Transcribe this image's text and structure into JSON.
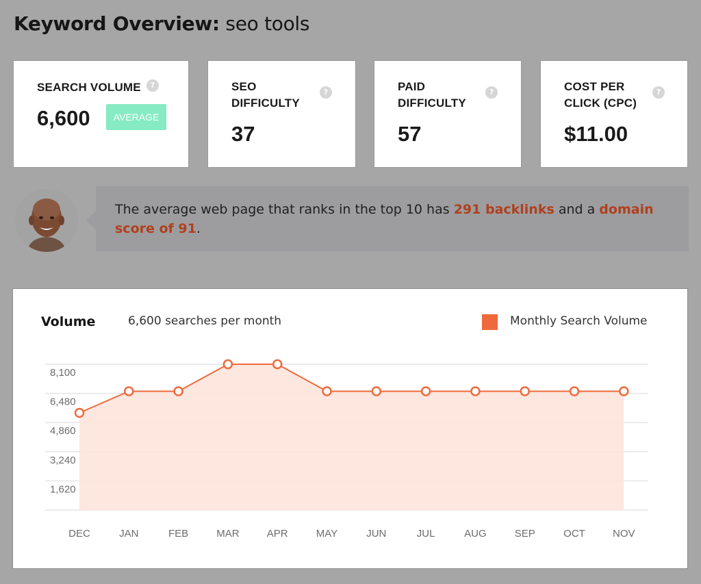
{
  "header": {
    "title_label": "Keyword Overview:",
    "keyword": "seo tools"
  },
  "metrics": [
    {
      "label_lines": [
        "SEARCH VOLUME"
      ],
      "value": "6,600",
      "badge": "AVERAGE",
      "help": "?"
    },
    {
      "label_lines": [
        "SEO",
        "DIFFICULTY"
      ],
      "value": "37",
      "help": "?"
    },
    {
      "label_lines": [
        "PAID",
        "DIFFICULTY"
      ],
      "value": "57",
      "help": "?"
    },
    {
      "label_lines": [
        "COST PER",
        "CLICK (CPC)"
      ],
      "value": "$11.00",
      "help": "?"
    }
  ],
  "tip": {
    "part1": "The average web page that ranks in the top 10 has ",
    "highlight1": "291 backlinks",
    "part2": " and a ",
    "highlight2": "domain score of 91",
    "part3": "."
  },
  "colors": {
    "accent": "#ee6a3c",
    "fill": "#fde4dc",
    "badge": "#86ebc3",
    "highlight": "#b0401d",
    "background": "#a6a6a6"
  },
  "chart_data": {
    "type": "area",
    "title": "Volume",
    "subtitle": "6,600 searches per month",
    "legend": [
      "Monthly Search Volume"
    ],
    "legend_position": "top-right",
    "categories": [
      "DEC",
      "JAN",
      "FEB",
      "MAR",
      "APR",
      "MAY",
      "JUN",
      "JUL",
      "AUG",
      "SEP",
      "OCT",
      "NOV"
    ],
    "series": [
      {
        "name": "Monthly Search Volume",
        "values": [
          5400,
          6600,
          6600,
          8100,
          8100,
          6600,
          6600,
          6600,
          6600,
          6600,
          6600,
          6600
        ]
      }
    ],
    "yticks": [
      1620,
      3240,
      4860,
      6480,
      8100
    ],
    "ytick_labels": [
      "1,620",
      "3,240",
      "4,860",
      "6,480",
      "8,100"
    ],
    "ylim": [
      0,
      8100
    ],
    "grid": true,
    "xlabel": "",
    "ylabel": ""
  }
}
